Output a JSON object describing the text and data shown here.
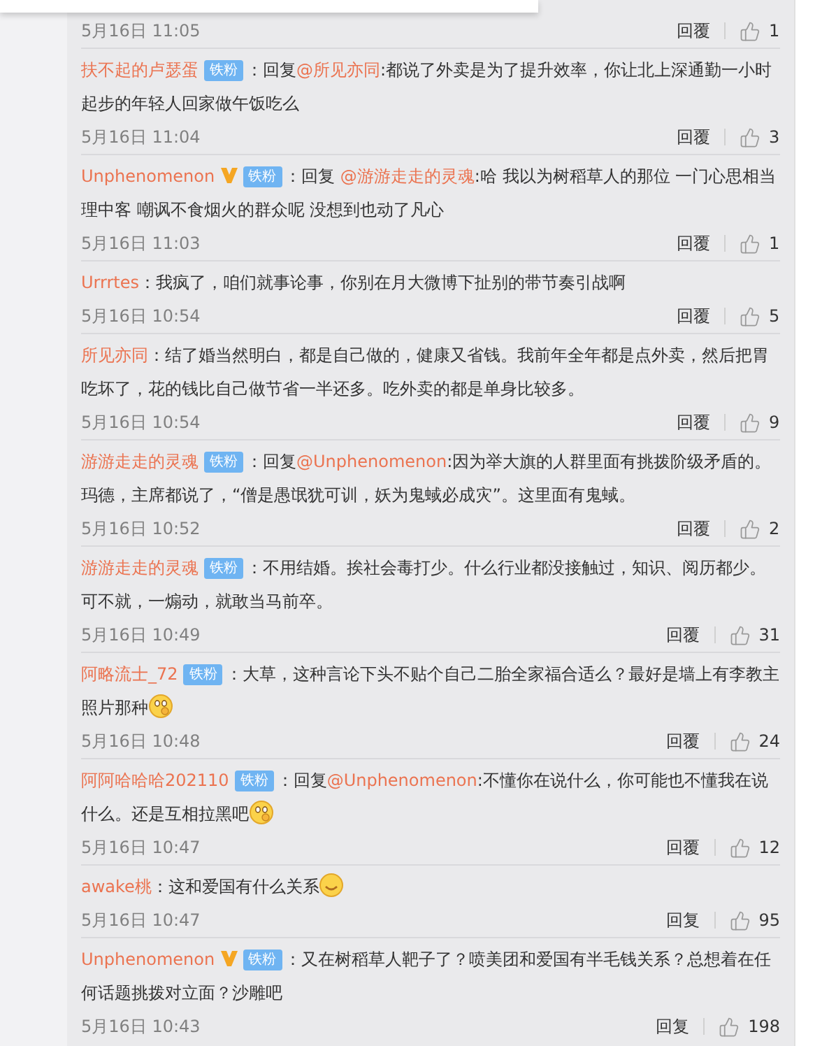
{
  "comments": [
    {
      "date": "5月16日 11:05",
      "reply": "回覆",
      "likes": "1"
    },
    {
      "name": "扶不起的卢瑟蛋",
      "verified": false,
      "badge": "铁粉",
      "body": [
        {
          "kind": "text",
          "text": "：回复"
        },
        {
          "kind": "mention",
          "text": "@所见亦同"
        },
        {
          "kind": "text",
          "text": ":都说了外卖是为了提升效率，你让北上深通勤一小时起步的年轻人回家做午饭吃么"
        }
      ],
      "date": "5月16日 11:04",
      "reply": "回覆",
      "likes": "3"
    },
    {
      "name": "Unphenomenon",
      "verified": true,
      "badge": "铁粉",
      "body": [
        {
          "kind": "text",
          "text": "：回复 "
        },
        {
          "kind": "mention",
          "text": "@游游走走的灵魂"
        },
        {
          "kind": "text",
          "text": ":哈  我以为树稻草人的那位  一门心思相当理中客 嘲讽不食烟火的群众呢    没想到也动了凡心"
        }
      ],
      "date": "5月16日 11:03",
      "reply": "回覆",
      "likes": "1"
    },
    {
      "name": "Urrrtes",
      "verified": false,
      "body": [
        {
          "kind": "text",
          "text": "：我疯了，咱们就事论事，你别在月大微博下扯别的带节奏引战啊"
        }
      ],
      "date": "5月16日 10:54",
      "reply": "回覆",
      "likes": "5"
    },
    {
      "name": "所见亦同",
      "verified": false,
      "body": [
        {
          "kind": "text",
          "text": "：结了婚当然明白，都是自己做的，健康又省钱。我前年全年都是点外卖，然后把胃吃坏了，花的钱比自己做节省一半还多。吃外卖的都是单身比较多。"
        }
      ],
      "date": "5月16日 10:54",
      "reply": "回覆",
      "likes": "9"
    },
    {
      "name": "游游走走的灵魂",
      "verified": false,
      "badge": "铁粉",
      "body": [
        {
          "kind": "text",
          "text": "：回复"
        },
        {
          "kind": "mention",
          "text": "@Unphenomenon"
        },
        {
          "kind": "text",
          "text": ":因为举大旗的人群里面有挑拨阶级矛盾的。玛德，主席都说了，“僧是愚氓犹可训，妖为鬼蜮必成灾”。这里面有鬼蜮。"
        }
      ],
      "date": "5月16日 10:52",
      "reply": "回覆",
      "likes": "2"
    },
    {
      "name": "游游走走的灵魂",
      "verified": false,
      "badge": "铁粉",
      "body": [
        {
          "kind": "text",
          "text": "：不用结婚。挨社会毒打少。什么行业都没接触过，知识、阅历都少。可不就，一煽动，就敢当马前卒。"
        }
      ],
      "date": "5月16日 10:49",
      "reply": "回覆",
      "likes": "31"
    },
    {
      "name": "阿略流士_72",
      "verified": false,
      "badge": "铁粉",
      "body": [
        {
          "kind": "text",
          "text": "：大草，这种言论下头不贴个自己二胎全家福合适么？最好是墙上有李教主照片那种"
        },
        {
          "kind": "emoji"
        }
      ],
      "date": "5月16日 10:48",
      "reply": "回覆",
      "likes": "24"
    },
    {
      "name": "阿阿哈哈哈202110",
      "verified": false,
      "badge": "铁粉",
      "body": [
        {
          "kind": "text",
          "text": "：回复"
        },
        {
          "kind": "mention",
          "text": "@Unphenomenon"
        },
        {
          "kind": "text",
          "text": ":不懂你在说什么，你可能也不懂我在说什么。还是互相拉黑吧"
        },
        {
          "kind": "emoji"
        }
      ],
      "date": "5月16日 10:47",
      "reply": "回覆",
      "likes": "12"
    },
    {
      "name": "awake桃",
      "verified": false,
      "body": [
        {
          "kind": "text",
          "text": "：这和爱国有什么关系"
        },
        {
          "kind": "smile"
        }
      ],
      "date": "5月16日 10:47",
      "reply": "回复",
      "likes": "95"
    },
    {
      "name": "Unphenomenon",
      "verified": true,
      "badge": "铁粉",
      "body": [
        {
          "kind": "text",
          "text": "：又在树稻草人靶子了？喷美团和爱国有半毛钱关系？总想着在任何话题挑拨对立面？沙雕吧"
        }
      ],
      "date": "5月16日 10:43",
      "reply": "回复",
      "likes": "198"
    }
  ]
}
